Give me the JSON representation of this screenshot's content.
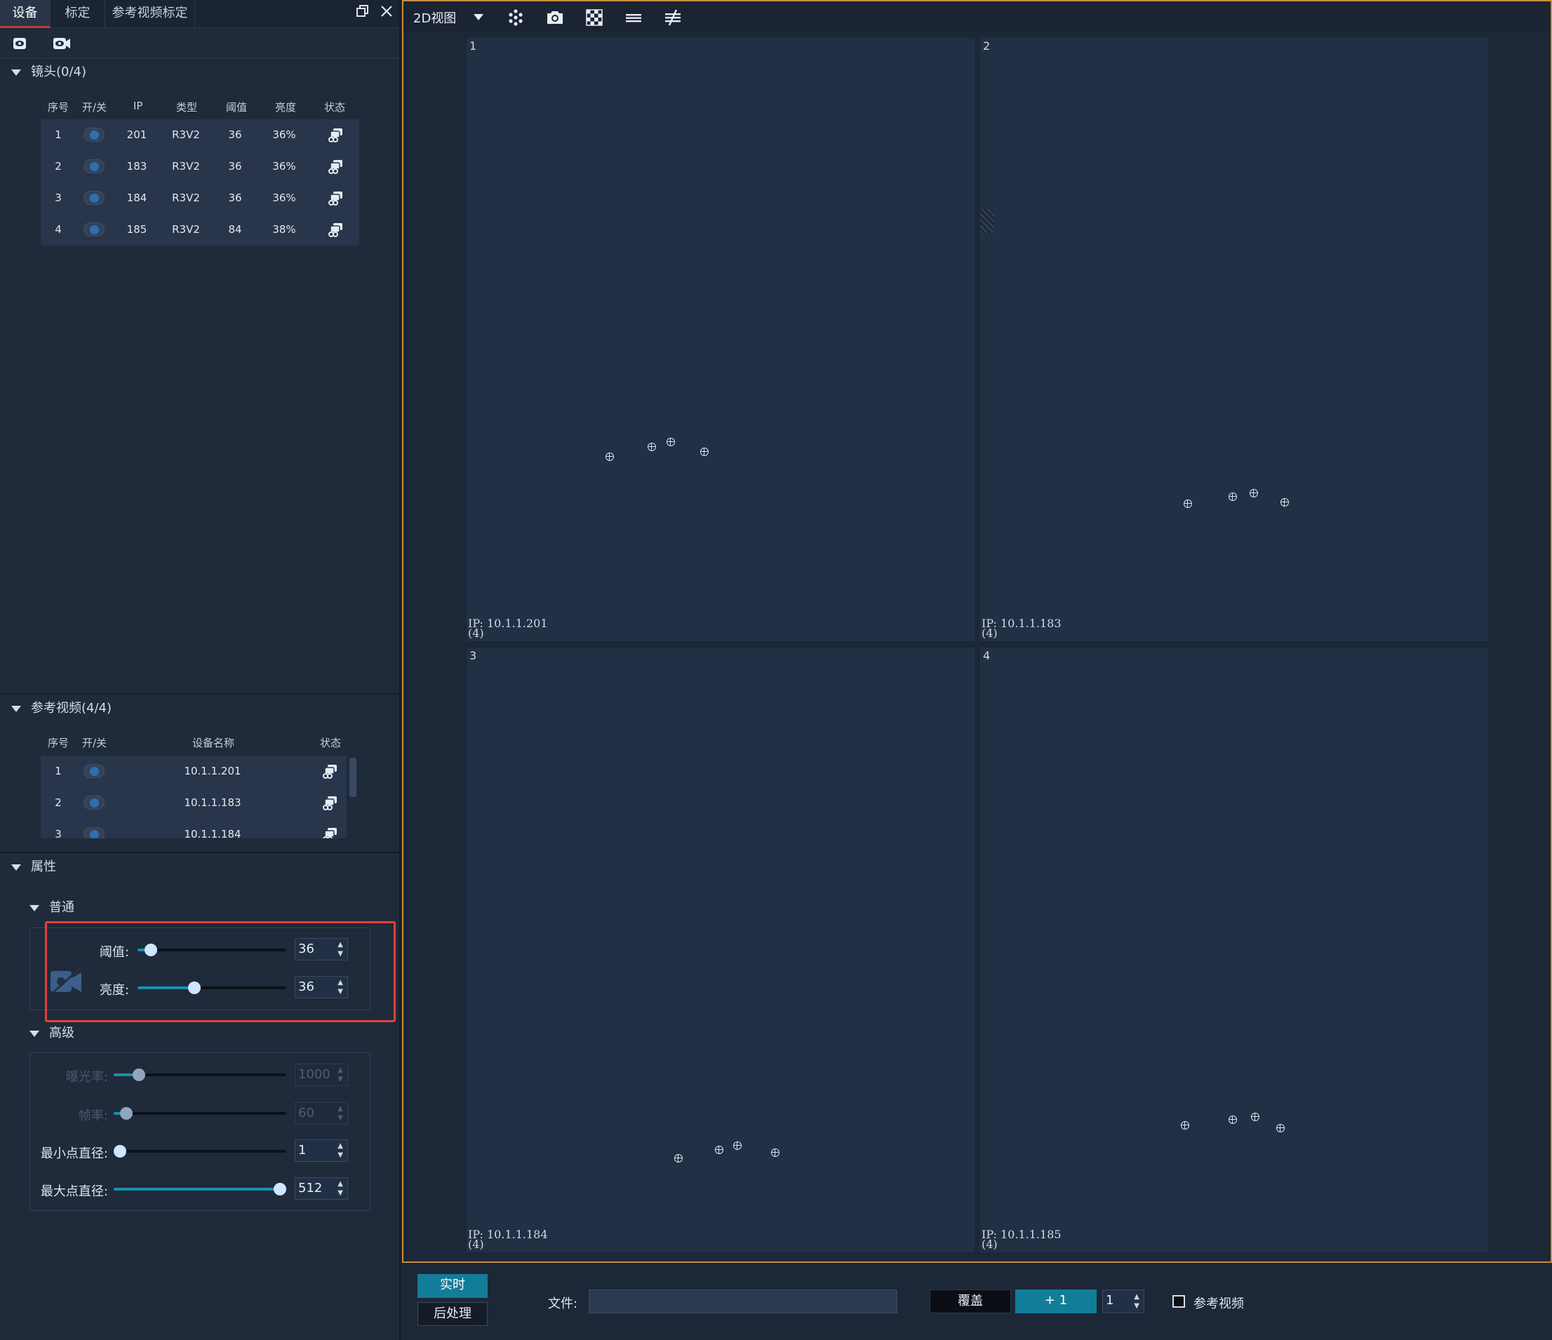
{
  "tabs": [
    {
      "label": "设备",
      "active": true
    },
    {
      "label": "标定",
      "active": false
    },
    {
      "label": "参考视频标定",
      "active": false
    }
  ],
  "lens_section": {
    "title": "镜头(0/4)",
    "columns": [
      "序号",
      "开/关",
      "IP",
      "类型",
      "阈值",
      "亮度",
      "状态"
    ],
    "rows": [
      {
        "idx": "1",
        "ip": "201",
        "type": "R3V2",
        "threshold": "36",
        "brightness": "36%"
      },
      {
        "idx": "2",
        "ip": "183",
        "type": "R3V2",
        "threshold": "36",
        "brightness": "36%"
      },
      {
        "idx": "3",
        "ip": "184",
        "type": "R3V2",
        "threshold": "36",
        "brightness": "36%"
      },
      {
        "idx": "4",
        "ip": "185",
        "type": "R3V2",
        "threshold": "84",
        "brightness": "38%"
      }
    ]
  },
  "ref_section": {
    "title": "参考视频(4/4)",
    "columns": [
      "序号",
      "开/关",
      "设备名称",
      "状态"
    ],
    "rows": [
      {
        "idx": "1",
        "name": "10.1.1.201"
      },
      {
        "idx": "2",
        "name": "10.1.1.183"
      },
      {
        "idx": "3",
        "name": "10.1.1.184"
      }
    ]
  },
  "props": {
    "title": "属性",
    "general": {
      "title": "普通",
      "threshold_label": "阈值:",
      "threshold_value": "36",
      "threshold_level": 0.05,
      "brightness_label": "亮度:",
      "brightness_value": "36",
      "brightness_level": 0.37
    },
    "advanced": {
      "title": "高级",
      "exposure_label": "曝光率:",
      "exposure_value": "1000",
      "exposure_level": 0.12,
      "fps_label": "帧率:",
      "fps_value": "60",
      "fps_level": 0.04,
      "min_label": "最小点直径:",
      "min_value": "1",
      "min_level": 0.0,
      "max_label": "最大点直径:",
      "max_value": "512",
      "max_level": 1.0
    }
  },
  "toolbar": {
    "view_mode": "2D视图"
  },
  "views": [
    {
      "num": "1",
      "ip": "IP: 10.1.1.201",
      "count": "(4)"
    },
    {
      "num": "2",
      "ip": "IP: 10.1.1.183",
      "count": "(4)"
    },
    {
      "num": "3",
      "ip": "IP: 10.1.1.184",
      "count": "(4)"
    },
    {
      "num": "4",
      "ip": "IP: 10.1.1.185",
      "count": "(4)"
    }
  ],
  "bottom": {
    "realtime_label": "实时",
    "post_label": "后处理",
    "file_label": "文件:",
    "file_value": "",
    "overwrite_label": "覆盖",
    "plus_label": "+ 1",
    "count_value": "1",
    "ref_video_label": "参考视频"
  },
  "colors": {
    "accent": "#1a8fb0",
    "border_highlight": "#c98d3e",
    "annotation": "#e0413a"
  }
}
